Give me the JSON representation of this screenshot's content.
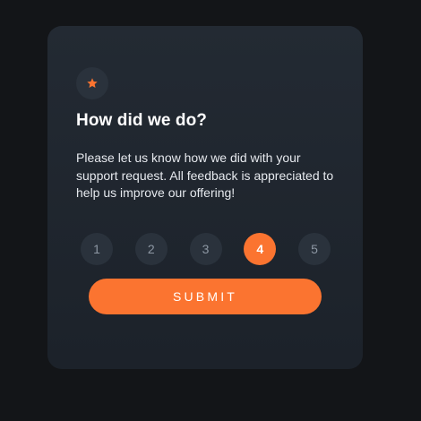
{
  "card": {
    "icon": "star-icon",
    "title": "How did we do?",
    "description": "Please let us know how we did with your support request. All feedback is appreciated to help us improve our offering!"
  },
  "ratings": {
    "options": [
      "1",
      "2",
      "3",
      "4",
      "5"
    ],
    "selected": "4"
  },
  "submit": {
    "label": "SUBMIT"
  },
  "colors": {
    "background": "#131518",
    "card": "#232a33",
    "accent": "#fb7430",
    "circle": "#2a323c",
    "muted_text": "#8d97a3"
  }
}
